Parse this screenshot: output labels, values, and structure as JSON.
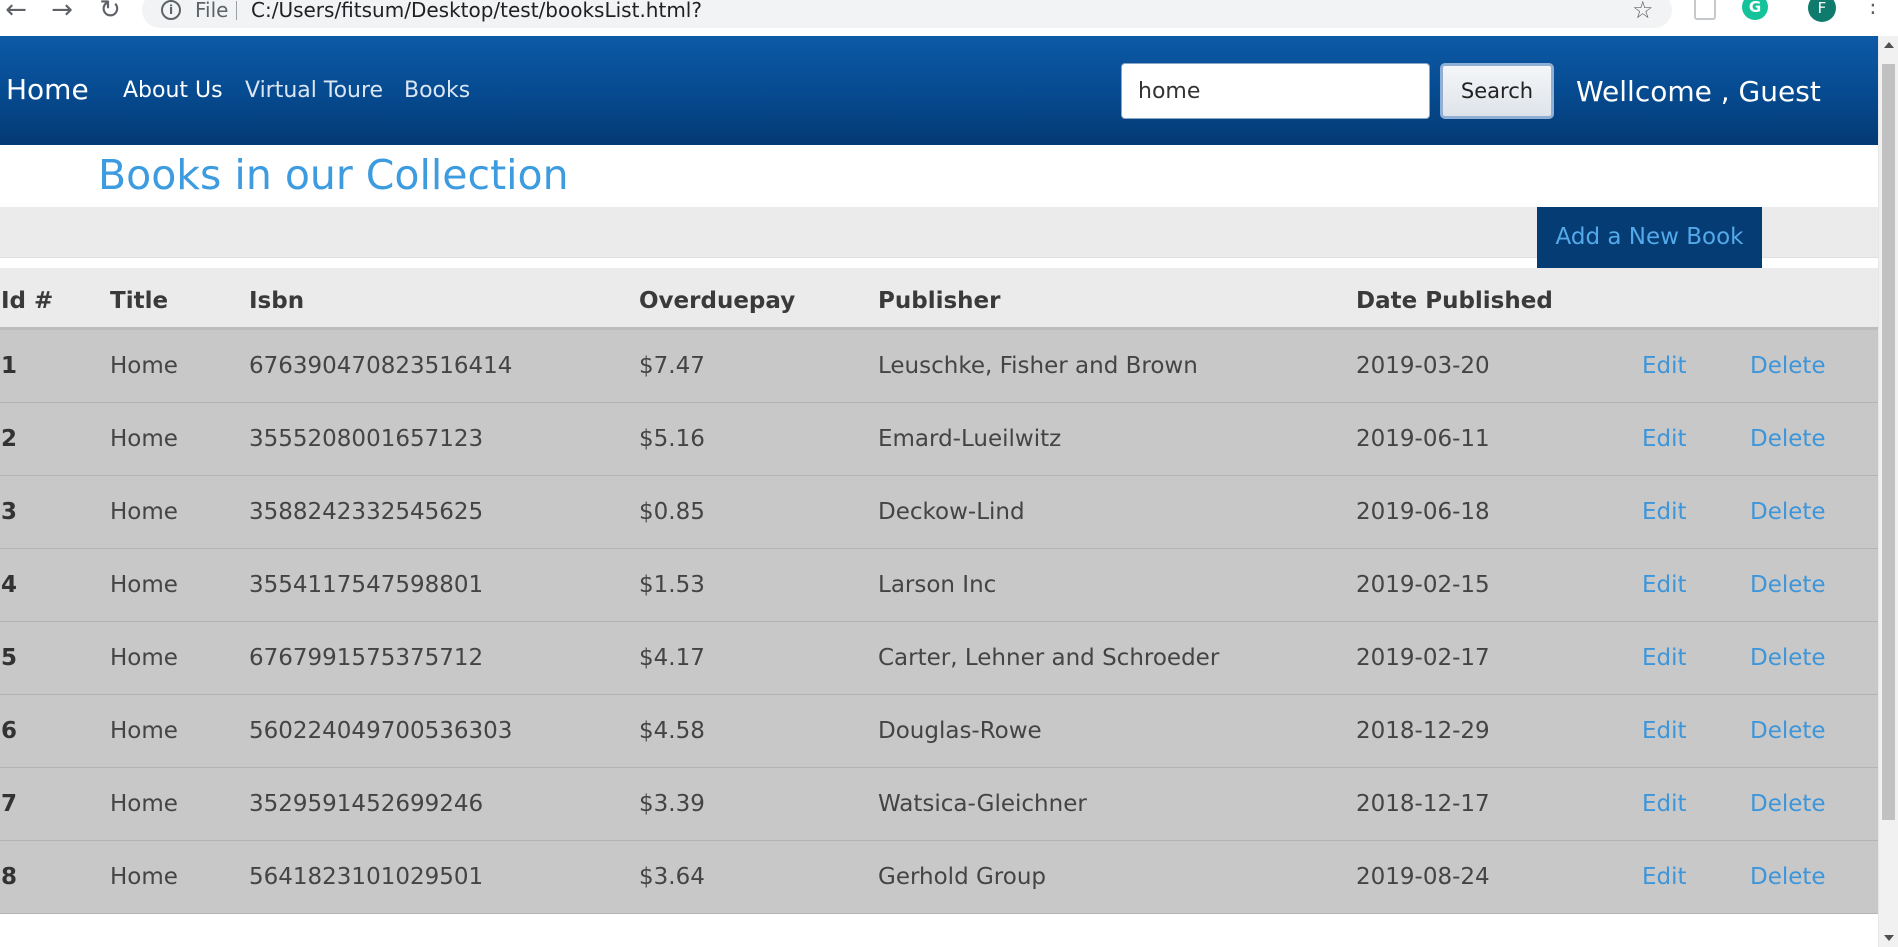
{
  "browser": {
    "file_label": "File",
    "url": "C:/Users/fitsum/Desktop/test/booksList.html?",
    "profile_initial": "F",
    "extension_badge": "G"
  },
  "navbar": {
    "brand": "Home",
    "links": [
      "About Us",
      "Virtual Toure",
      "Books"
    ],
    "search_value": "home",
    "search_button": "Search",
    "welcome": "Wellcome , Guest"
  },
  "page": {
    "title": "Books in our Collection",
    "add_button": "Add a New Book"
  },
  "table": {
    "headers": [
      "Id #",
      "Title",
      "Isbn",
      "Overduepay",
      "Publisher",
      "Date Published"
    ],
    "edit_label": "Edit",
    "delete_label": "Delete",
    "rows": [
      {
        "id": "1",
        "title": "Home",
        "isbn": "676390470823516414",
        "overdue": "$7.47",
        "publisher": "Leuschke, Fisher and Brown",
        "date": "2019-03-20"
      },
      {
        "id": "2",
        "title": "Home",
        "isbn": "3555208001657123",
        "overdue": "$5.16",
        "publisher": "Emard-Lueilwitz",
        "date": "2019-06-11"
      },
      {
        "id": "3",
        "title": "Home",
        "isbn": "3588242332545625",
        "overdue": "$0.85",
        "publisher": "Deckow-Lind",
        "date": "2019-06-18"
      },
      {
        "id": "4",
        "title": "Home",
        "isbn": "3554117547598801",
        "overdue": "$1.53",
        "publisher": "Larson Inc",
        "date": "2019-02-15"
      },
      {
        "id": "5",
        "title": "Home",
        "isbn": "6767991575375712",
        "overdue": "$4.17",
        "publisher": "Carter, Lehner and Schroeder",
        "date": "2019-02-17"
      },
      {
        "id": "6",
        "title": "Home",
        "isbn": "560224049700536303",
        "overdue": "$4.58",
        "publisher": "Douglas-Rowe",
        "date": "2018-12-29"
      },
      {
        "id": "7",
        "title": "Home",
        "isbn": "3529591452699246",
        "overdue": "$3.39",
        "publisher": "Watsica-Gleichner",
        "date": "2018-12-17"
      },
      {
        "id": "8",
        "title": "Home",
        "isbn": "5641823101029501",
        "overdue": "$3.64",
        "publisher": "Gerhold Group",
        "date": "2019-08-24"
      }
    ]
  },
  "colors": {
    "navbar": "#064b91",
    "title": "#3d9be0",
    "link": "#3d95da",
    "add_button_bg": "#063c74",
    "row_bg": "#c8c8c8"
  }
}
